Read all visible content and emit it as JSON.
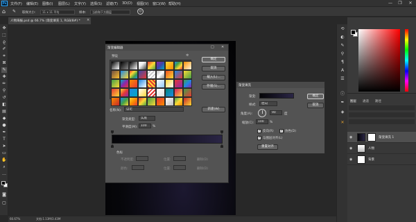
{
  "app": {
    "logo": "Ps",
    "menus": [
      "文件(F)",
      "编辑(E)",
      "图像(I)",
      "图层(L)",
      "文字(Y)",
      "选择(S)",
      "滤镜(T)",
      "3D(D)",
      "视图(V)",
      "窗口(W)",
      "帮助(H)"
    ],
    "window_buttons": [
      "—",
      "❐",
      "✕"
    ]
  },
  "options": {
    "sample_size_label": "取样大小:",
    "sample_size_value": "11 x 11 平均",
    "sample_label": "样本:",
    "sample_value": "当前和下方图层"
  },
  "document": {
    "tab_label": "人物海报.psd @ 66.7% (渐变填充 1, RGB/8#) *",
    "zoom": "66.67%",
    "doc_info": "文档:1.13M/3.43M"
  },
  "gradient_editor": {
    "title": "渐变编辑器",
    "presets_label": "预设",
    "ok": "确定",
    "cancel": "取消",
    "load": "载入(L)...",
    "save": "存储(S)...",
    "name_label": "名称(N):",
    "name_value": "自定",
    "new_button": "新建(W)",
    "type_label": "渐变类型:",
    "type_value": "实底",
    "smoothness_label": "平滑度(M):",
    "smoothness_value": "100",
    "smoothness_unit": "%",
    "stops_label": "色标",
    "opacity_label": "不透明度:",
    "location_label_1": "位置:",
    "delete_label_1": "删除(D)",
    "color_label": "颜色:",
    "location_label_2": "位置:",
    "delete_label_2": "删除(D)",
    "presets": [
      "linear-gradient(135deg,#000,#fff)",
      "linear-gradient(135deg,#000,#888)",
      "linear-gradient(135deg,#000,#fff)",
      "linear-gradient(135deg,#fff,#eee 40%,transparent)",
      "linear-gradient(135deg,#e53935,#fdd835,#43a047)",
      "linear-gradient(135deg,#8e24aa,#3949ab,#00acc1)",
      "linear-gradient(135deg,#fdd835,#fb8c00)",
      "linear-gradient(135deg,#1e88e5,#43a047,#fdd835,#e53935)",
      "linear-gradient(135deg,#ff8f00,#fff8e1)",
      "linear-gradient(135deg,#6d4c41,#fbc02d)",
      "linear-gradient(135deg,#1e88e5,#fdd835)",
      "linear-gradient(135deg,#e53935,#fdd835,#43a047,#1e88e5)",
      "linear-gradient(135deg,#3949ab,#e53935)",
      "repeating-linear-gradient(135deg,#fff 0,#fff 2px,#ccc 2px,#ccc 4px)",
      "linear-gradient(135deg,#c0c0c0,#fff,#888)",
      "linear-gradient(135deg,#f4511e,#fdd835)",
      "linear-gradient(135deg,#1e88e5,#e53935)",
      "linear-gradient(135deg,#fdd835,#43a047)",
      "linear-gradient(135deg,#43a047,#fdd835)",
      "linear-gradient(135deg,#00acc1,#8e24aa,#e53935)",
      "linear-gradient(135deg,#fb8c00,#e53935)",
      "linear-gradient(135deg,#1e88e5,#ffffff)",
      "repeating-linear-gradient(45deg,#e53935 0,#e53935 2px,#fdd835 2px,#fdd835 4px)",
      "linear-gradient(135deg,#fff,#90caf9)",
      "linear-gradient(135deg,#fdd835,#fff)",
      "linear-gradient(135deg,#e53935,#8e24aa)",
      "linear-gradient(135deg,#43a047,#1e88e5,#8e24aa)",
      "linear-gradient(135deg,#e53935,#fdd835)",
      "linear-gradient(135deg,#fdd835,#e53935,#8e24aa)",
      "linear-gradient(135deg,#1e88e5,#00acc1)",
      "linear-gradient(135deg,#fff,#fdd835)",
      "repeating-linear-gradient(135deg,#e53935 0,#e53935 2px,#fff 2px,#fff 4px)",
      "linear-gradient(135deg,#fff,#e0e0e0)",
      "linear-gradient(135deg,#00897b,#1e88e5)",
      "linear-gradient(135deg,#d81b60,#fdd835)",
      "linear-gradient(135deg,#43a047,#e53935)",
      "linear-gradient(135deg,#fb8c00,#c62828)",
      "linear-gradient(135deg,#1e88e5,#43a047,#fdd835)",
      "linear-gradient(135deg,#fdd835,#fb8c00,#e53935)",
      "linear-gradient(135deg,#e53935,#fdd835,#43a047)",
      "linear-gradient(135deg,#43a047,#fdd835)",
      "linear-gradient(135deg,#e53935,#fb8c00)",
      "linear-gradient(135deg,#fff,#bdbdbd)",
      "linear-gradient(135deg,#43a047,#fdd835,#fb8c00)",
      "linear-gradient(135deg,#c62828,#fdd835)"
    ]
  },
  "gradient_fill": {
    "title": "渐变填充",
    "gradient_label": "渐变:",
    "style_label": "样式:",
    "style_value": "径向",
    "angle_label": "角度(A):",
    "angle_value": "90",
    "angle_unit": "度",
    "scale_label": "缩放(C):",
    "scale_value": "100",
    "scale_unit": "%",
    "reverse_label": "反向(R)",
    "dither_label": "仿色(D)",
    "align_label": "与图层对齐(L)",
    "reset_button": "重置对齐",
    "ok": "确定",
    "cancel": "取消"
  },
  "layers_panel": {
    "tabs": [
      "图层",
      "通道",
      "路径"
    ],
    "layers": [
      {
        "name": "渐变填充 1",
        "thumb": "linear-gradient(to right,#050508,#2a2545)"
      },
      {
        "name": "人物",
        "thumb": "linear-gradient(#fff,#bbb)"
      },
      {
        "name": "背景",
        "thumb": "#ffffff"
      }
    ]
  },
  "colors": {
    "ui_bg": "#282828",
    "panel": "#383838",
    "dialog": "#535353",
    "accent": "#31a8ff"
  }
}
